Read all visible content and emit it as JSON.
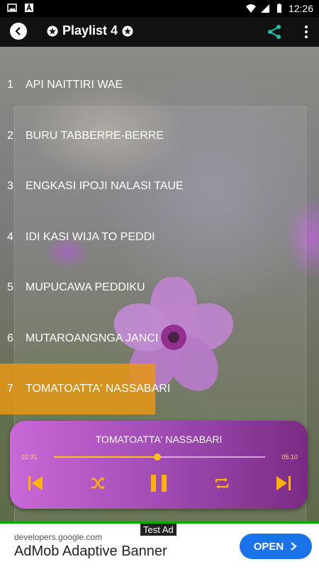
{
  "status_bar": {
    "time": "12:26"
  },
  "app_bar": {
    "title": "Playlist 4"
  },
  "tracks": [
    {
      "num": "1",
      "name": "API NAITTIRI WAE"
    },
    {
      "num": "2",
      "name": "BURU TABBERRE-BERRE"
    },
    {
      "num": "3",
      "name": "ENGKASI IPOJI NALASI TAUE"
    },
    {
      "num": "4",
      "name": "IDI KASI WIJA TO PEDDI"
    },
    {
      "num": "5",
      "name": "MUPUCAWA PEDDIKU"
    },
    {
      "num": "6",
      "name": "MUTAROANGNGA JANCI"
    },
    {
      "num": "7",
      "name": "TOMATOATTA' NASSABARI"
    }
  ],
  "active_track_index": 6,
  "player": {
    "now_playing": "TOMATOATTA' NASSABARI",
    "current_time": "02:31",
    "total_time": "05:10",
    "progress": 0.49
  },
  "ad": {
    "tag": "Test Ad",
    "domain": "developers.google.com",
    "title": "AdMob Adaptive Banner",
    "button": "OPEN"
  },
  "colors": {
    "accent": "#ffc21a",
    "share": "#1fc2a8",
    "highlight": "#e69614",
    "ad_button": "#1a73e8"
  }
}
